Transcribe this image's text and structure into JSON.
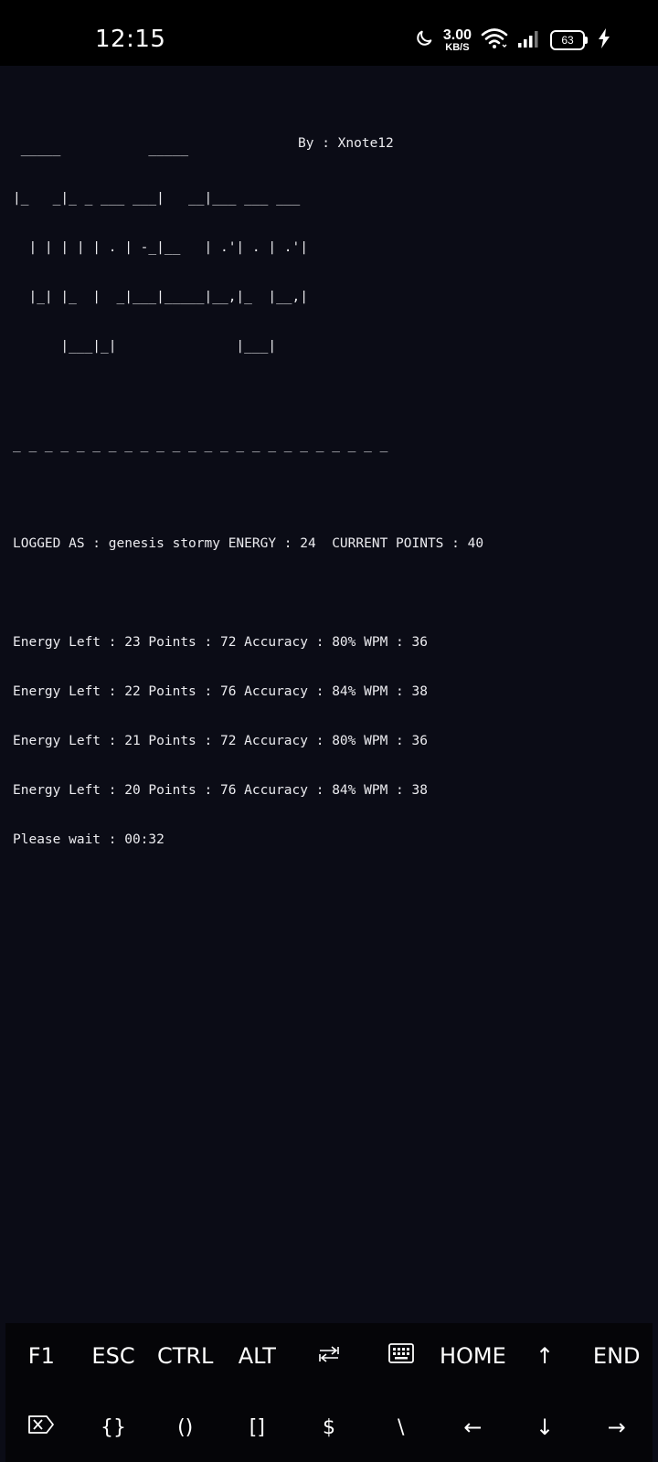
{
  "status_bar": {
    "time": "12:15",
    "net_speed_value": "3.00",
    "net_speed_unit": "KB/S",
    "battery_level": "63",
    "icons": [
      "moon-icon",
      "wifi-icon",
      "signal-icon",
      "battery-icon",
      "charging-icon"
    ]
  },
  "terminal": {
    "ascii_art": [
      " _____           _____",
      "|_   _|_ _ ___ ___|   __|___ ___ ___",
      "  | | | | | . | -_|__   | .'| . | .'|",
      "  |_| |_  |  _|___|_____|__,|_  |__,|",
      "      |___|_|               |___|"
    ],
    "author": "By : Xnote12",
    "separator": "_ _ _ _ _ _ _ _ _ _ _ _ _ _ _ _ _ _ _ _ _ _ _ _",
    "logged_line": "LOGGED AS : genesis stormy ENERGY : 24  CURRENT POINTS : 40",
    "results": [
      "Energy Left : 23 Points : 72 Accuracy : 80% WPM : 36",
      "Energy Left : 22 Points : 76 Accuracy : 84% WPM : 38",
      "Energy Left : 21 Points : 72 Accuracy : 80% WPM : 36",
      "Energy Left : 20 Points : 76 Accuracy : 84% WPM : 38"
    ],
    "wait_line": "Please wait : 00:32"
  },
  "extra_keys": {
    "row1": [
      "F1",
      "ESC",
      "CTRL",
      "ALT",
      "⭾",
      "⌨",
      "HOME",
      "↑",
      "END"
    ],
    "row2": [
      "⌦",
      "{}",
      "()",
      "[]",
      "$",
      "\\",
      "←",
      "↓",
      "→"
    ],
    "icons": {
      "tab_key": "tab-icon",
      "keyboard_key": "keyboard-icon",
      "delete_key": "backspace-icon"
    }
  }
}
